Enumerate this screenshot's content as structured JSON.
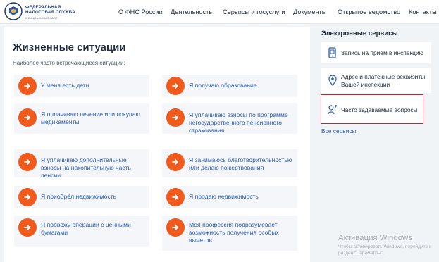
{
  "header": {
    "logo_line1": "ФЕДЕРАЛЬНАЯ",
    "logo_line2": "НАЛОГОВАЯ СЛУЖБА",
    "logo_sub": "ОФИЦИАЛЬНЫЙ САЙТ",
    "nav": [
      "О ФНС России",
      "Деятельность",
      "Сервисы и госуслуги",
      "Документы",
      "Открытое ведомство",
      "Контакты"
    ]
  },
  "main": {
    "title": "Жизненные ситуации",
    "subtitle": "Наиболее часто встречающиеся ситуации:",
    "situations": [
      "У меня есть дети",
      "Я получаю образование",
      "Я оплачиваю лечение или покупаю медикаменты",
      "Я уплачиваю взносы по программе негосударственного пенсионного страхования",
      "Я уплачиваю дополнительные взносы на накопительную часть пенсии",
      "Я занимаюсь благотворительностью или делаю пожертвования",
      "Я приобрёл недвижимость",
      "Я продаю недвижимость",
      "Я провожу операции с ценными бумагами",
      "Моя профессия подразумевает возможность получения особых вычетов"
    ]
  },
  "sidebar": {
    "title": "Электронные сервисы",
    "services": [
      {
        "label": "Запись на прием в инспекцию",
        "icon": "phone-calendar-icon"
      },
      {
        "label": "Адрес и платежные реквизиты Вашей инспекции",
        "icon": "location-pin-icon"
      },
      {
        "label": "Часто задаваемые вопросы",
        "icon": "question-person-icon"
      }
    ],
    "all_services": "Все сервисы"
  },
  "watermark": {
    "title": "Активация Windows",
    "sub": "Чтобы активировать Windows, перейдите в раздел \"Параметры\"."
  },
  "colors": {
    "accent": "#f05a1c",
    "link": "#2a5db0",
    "highlight": "#c0242e"
  }
}
